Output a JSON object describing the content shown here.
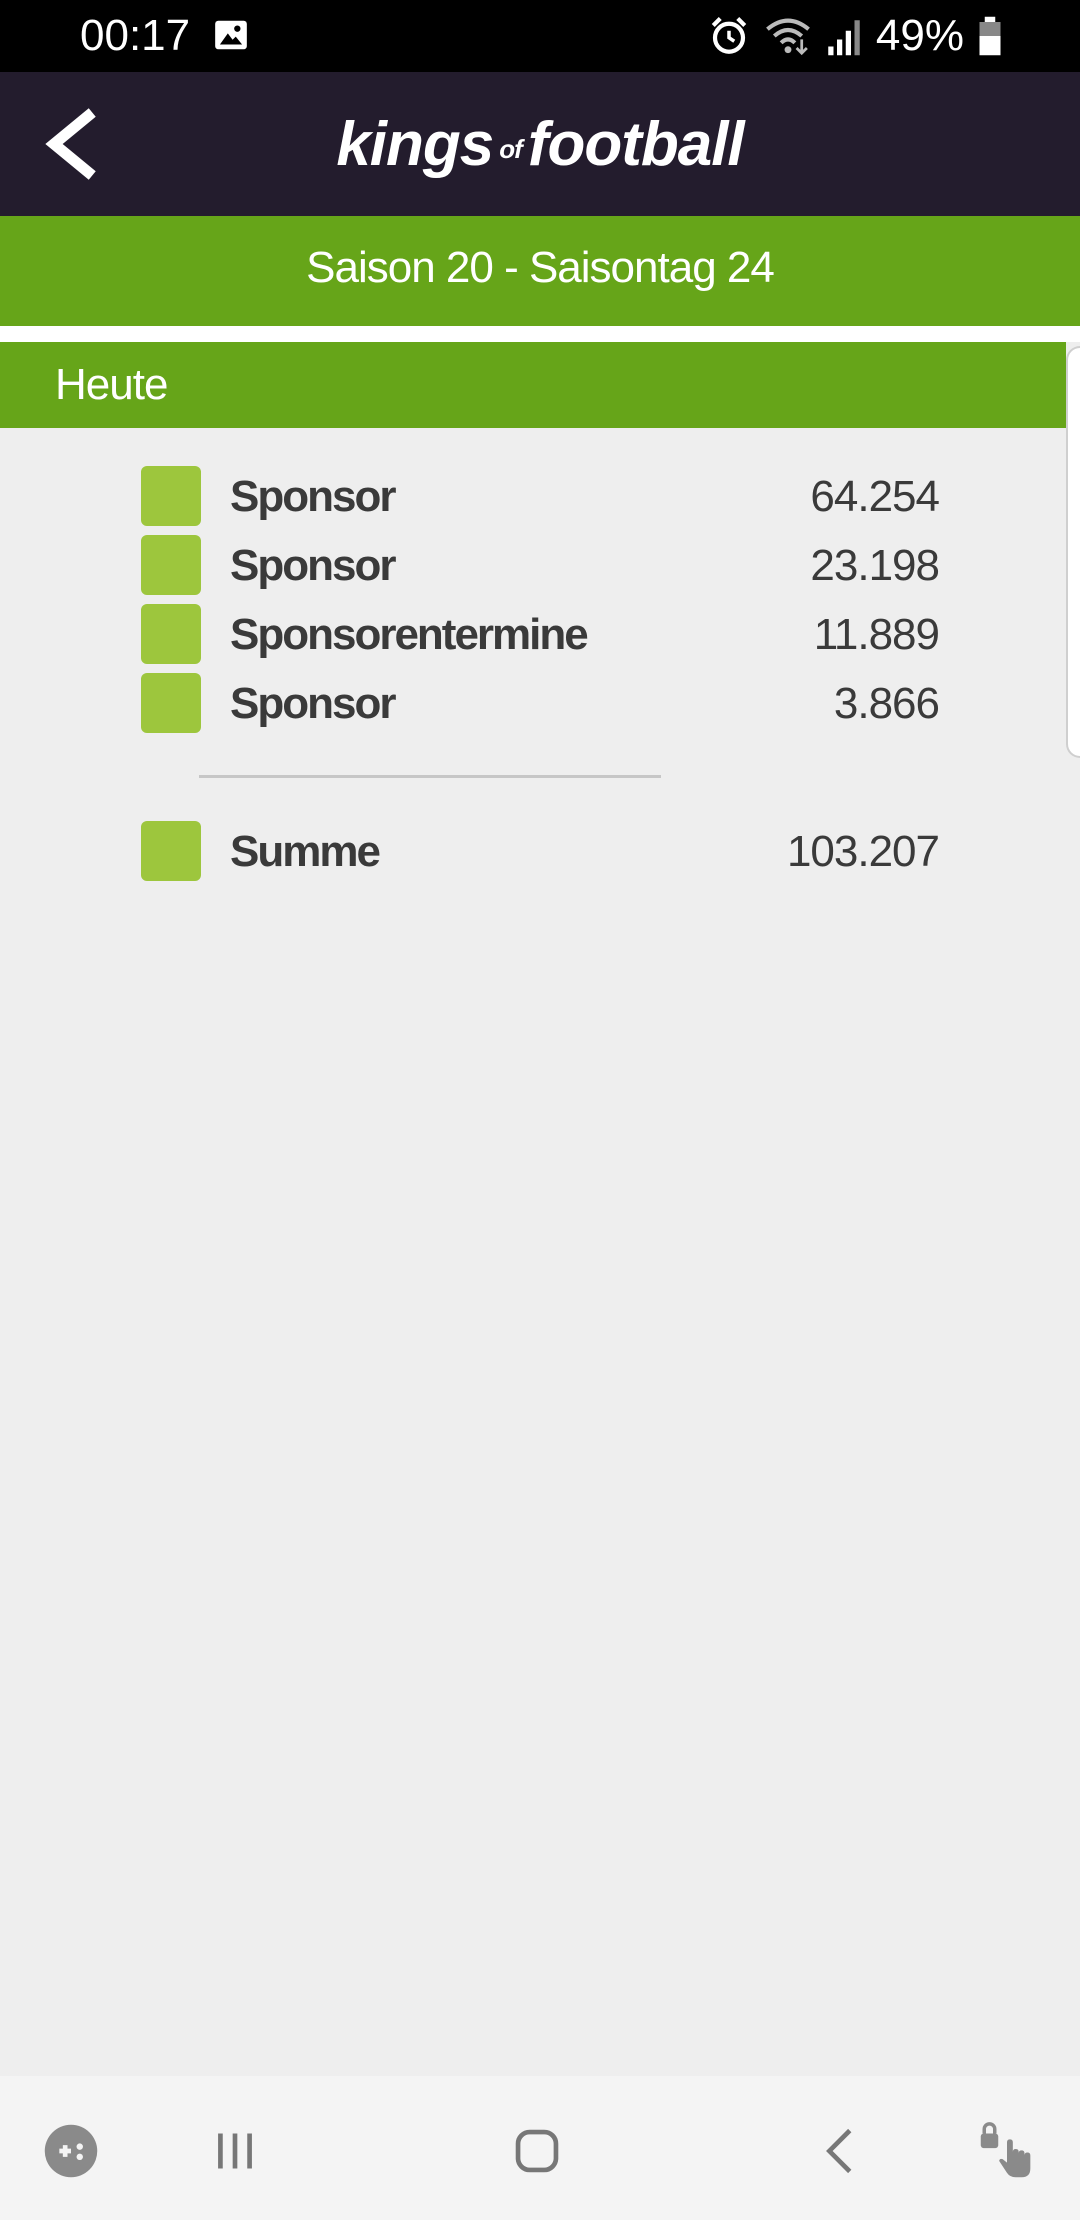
{
  "status_bar": {
    "time": "00:17",
    "battery_percent": "49%",
    "icons": [
      "image-icon",
      "alarm-icon",
      "wifi-icon",
      "signal-icon",
      "battery-icon"
    ]
  },
  "header": {
    "logo_part1": "kings",
    "logo_part2": "of",
    "logo_part3": "football",
    "back_icon": "chevron-left-icon"
  },
  "season": {
    "title": "Saison 20 - Saisontag 24"
  },
  "section": {
    "title": "Heute"
  },
  "items": [
    {
      "label": "Sponsor",
      "value": "64.254"
    },
    {
      "label": "Sponsor",
      "value": "23.198"
    },
    {
      "label": "Sponsorentermine",
      "value": "11.889"
    },
    {
      "label": "Sponsor",
      "value": "3.866"
    }
  ],
  "summary": {
    "label": "Summe",
    "value": "103.207"
  },
  "colors": {
    "header_bg": "#231c2d",
    "accent_green": "#66a519",
    "swatch_green": "#9dc63d",
    "page_bg": "#eeeeee"
  },
  "nav_bar": {
    "icons": [
      "game-launcher-icon",
      "recent-apps-icon",
      "home-icon",
      "back-icon",
      "touch-lock-icon"
    ]
  }
}
